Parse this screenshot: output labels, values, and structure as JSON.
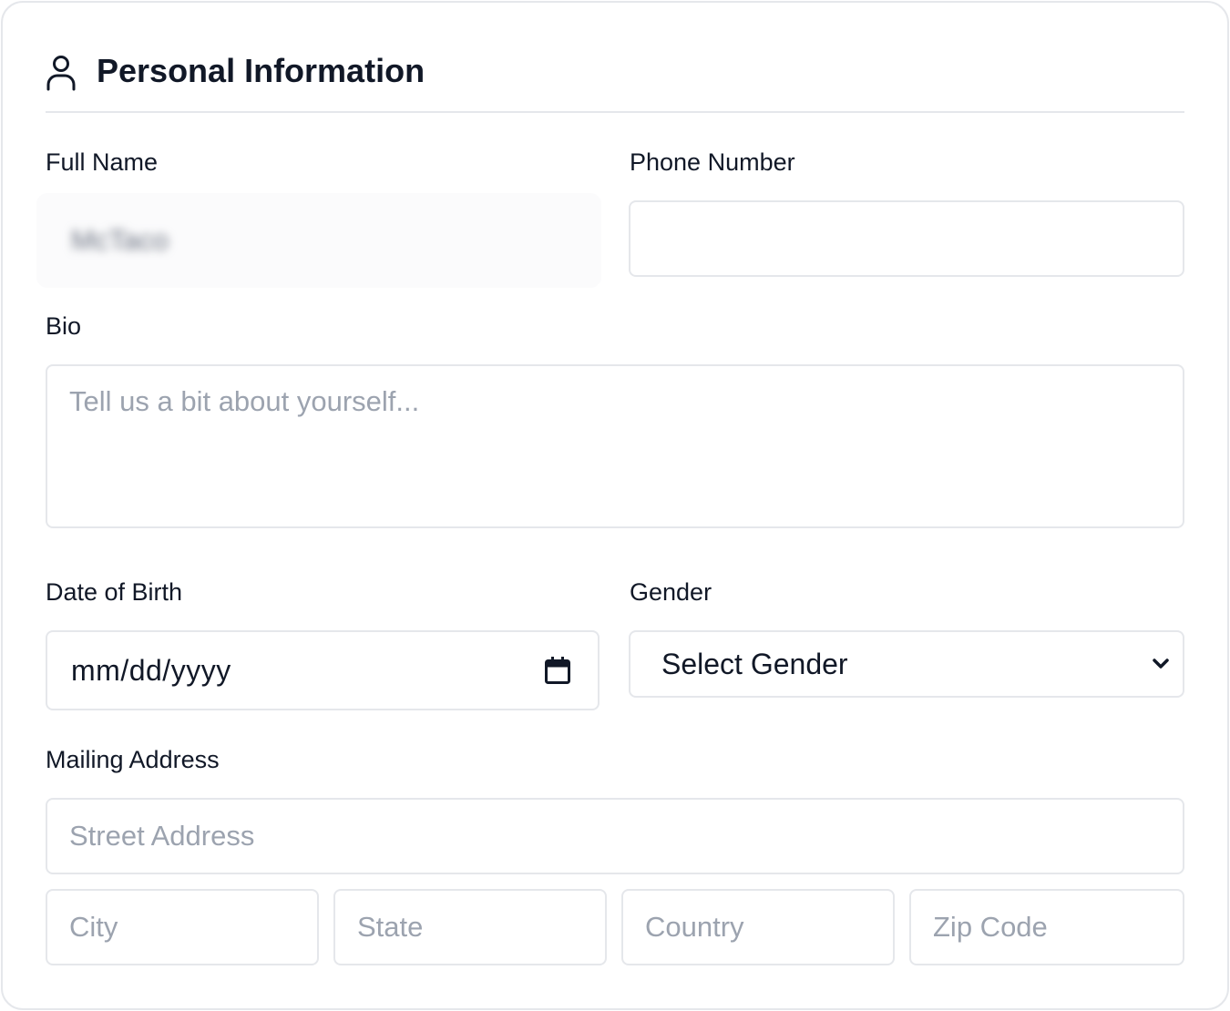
{
  "section": {
    "title": "Personal Information",
    "icon": "user-icon"
  },
  "full_name": {
    "label": "Full Name",
    "value": "McTaco"
  },
  "phone": {
    "label": "Phone Number",
    "value": ""
  },
  "bio": {
    "label": "Bio",
    "placeholder": "Tell us a bit about yourself..."
  },
  "dob": {
    "label": "Date of Birth",
    "placeholder": "mm/dd/yyyy",
    "icon": "calendar-icon"
  },
  "gender": {
    "label": "Gender",
    "selected": "Select Gender",
    "icon": "chevron-down-icon"
  },
  "address": {
    "label": "Mailing Address",
    "street_placeholder": "Street Address",
    "city_placeholder": "City",
    "state_placeholder": "State",
    "country_placeholder": "Country",
    "zip_placeholder": "Zip Code"
  },
  "colors": {
    "border": "#e5e7eb",
    "text": "#111827",
    "placeholder": "#9ca3af"
  }
}
